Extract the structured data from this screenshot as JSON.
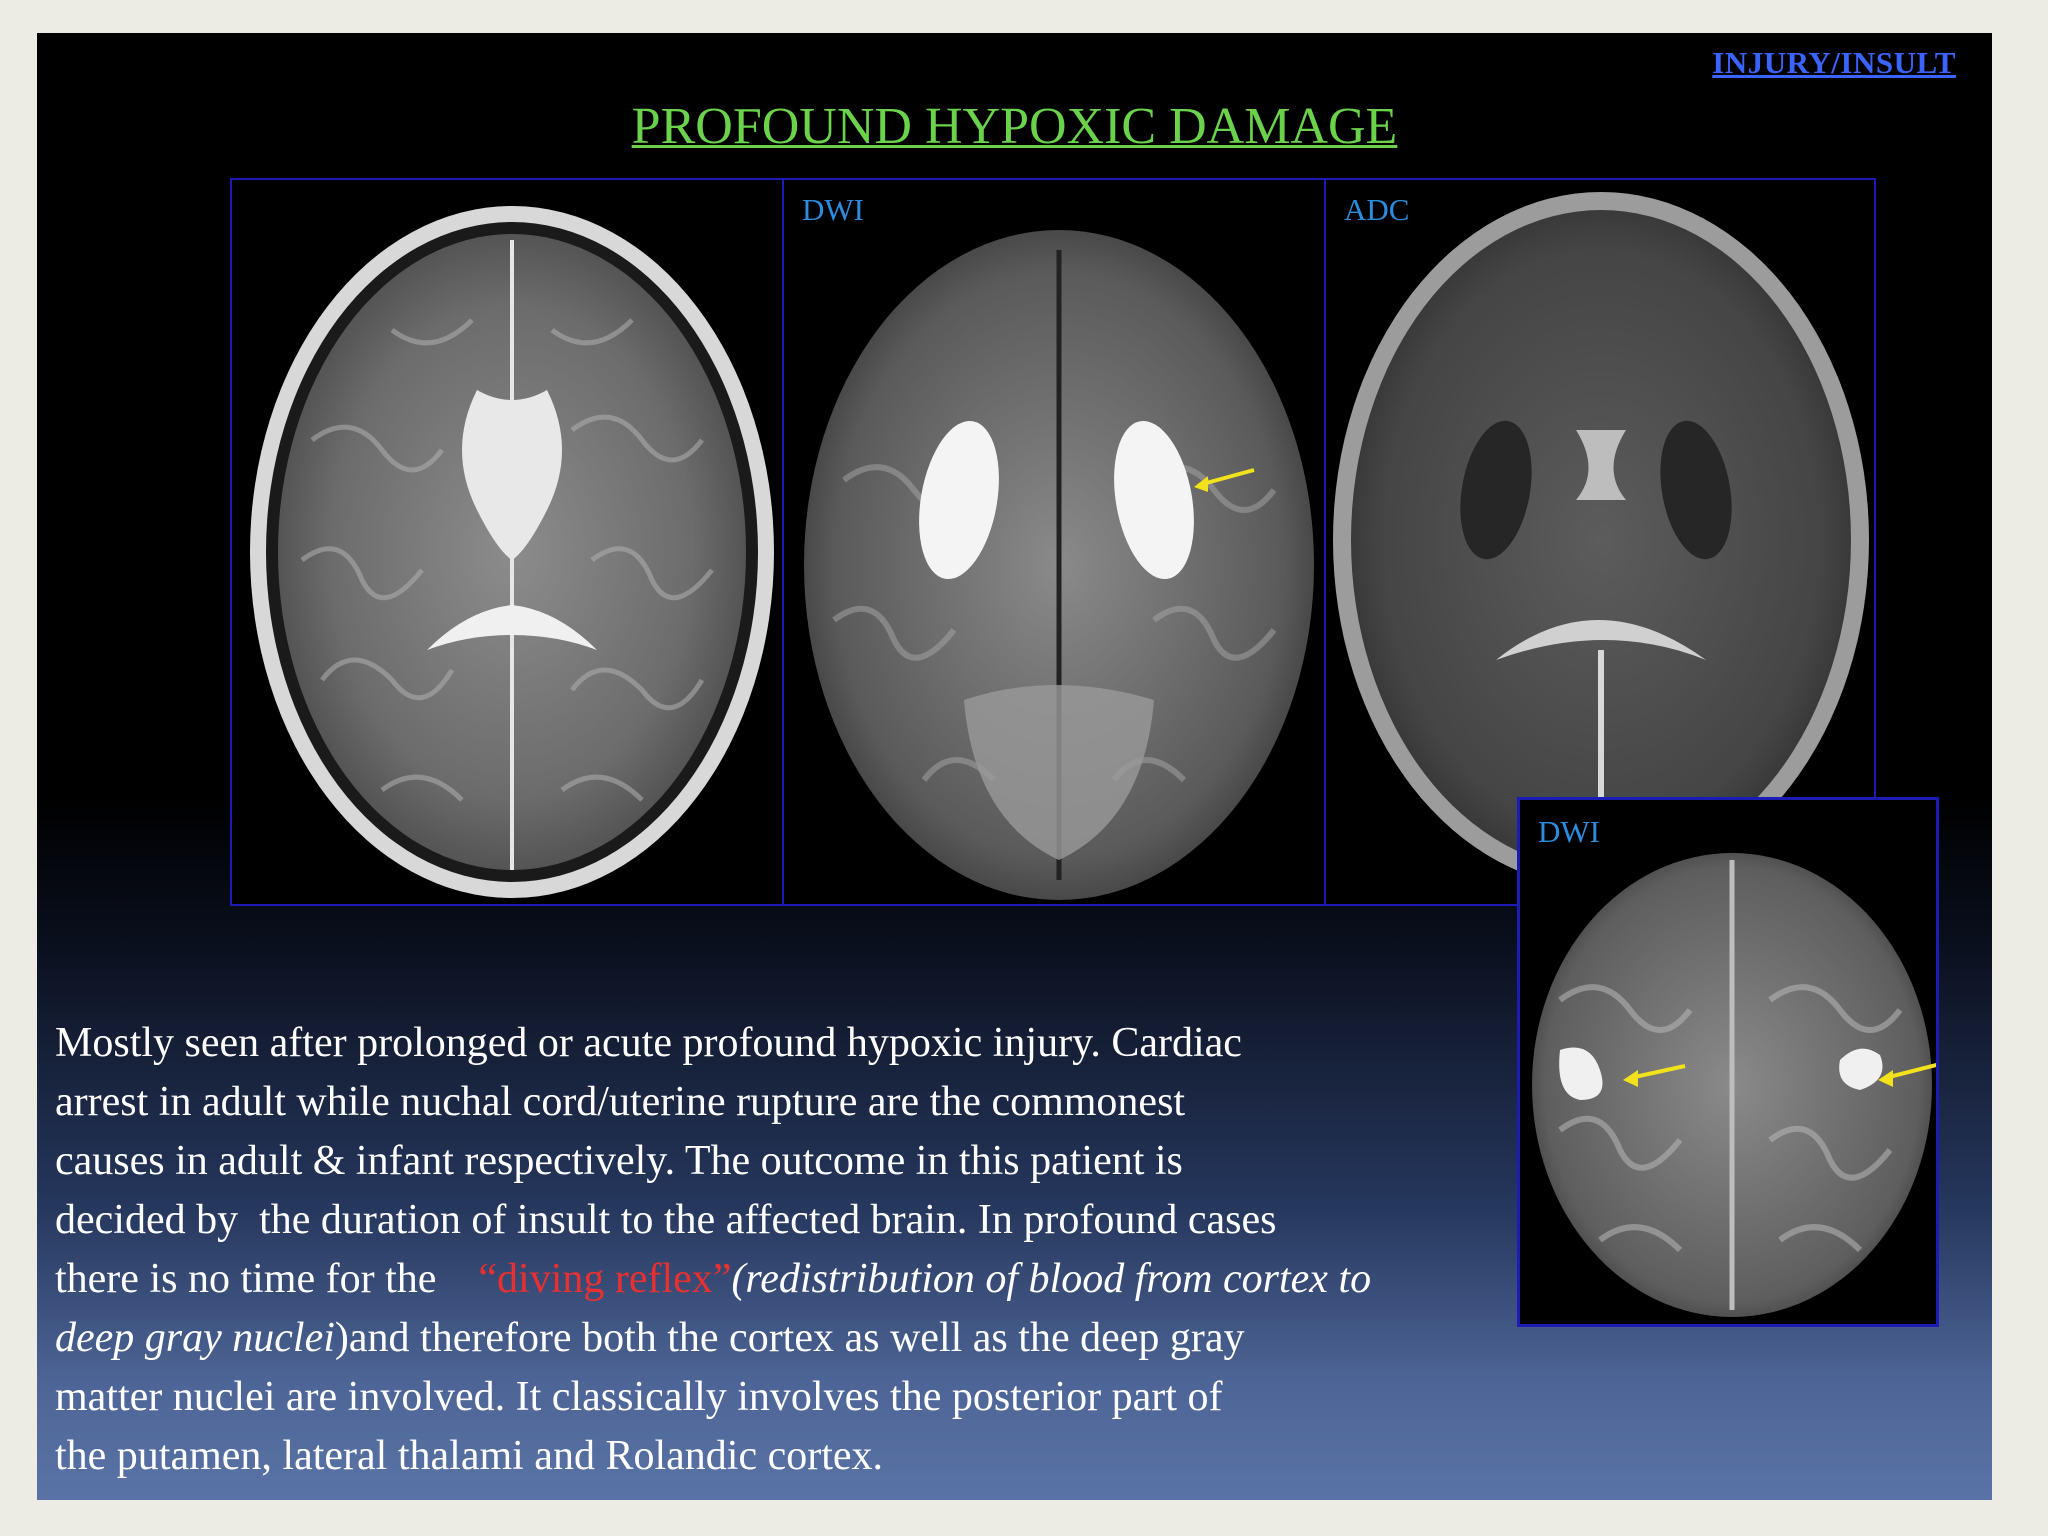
{
  "header": {
    "top_link": "INJURY/INSULT",
    "title": "PROFOUND HYPOXIC DAMAGE"
  },
  "panels": {
    "dwi_label": "DWI",
    "adc_label": "ADC",
    "inset_label": "DWI"
  },
  "body": {
    "line1": "Mostly seen after prolonged or acute profound hypoxic injury. Cardiac",
    "line2": "arrest in adult while nuchal cord/uterine rupture are the commonest",
    "line3": "causes in adult & infant respectively. The outcome in this patient is",
    "line4": "decided by  the duration of insult to the affected brain. In profound cases",
    "line5_a": "there is no time for the ",
    "line5_red": "“diving reflex”",
    "line5_it": "(redistribution of blood from cortex to",
    "line6_it": "deep gray nuclei",
    "line6_b": ")and therefore both the cortex as well as the deep gray",
    "line7": "matter nuclei are involved. It classically involves the posterior part of",
    "line8": "the putamen, lateral thalami and Rolandic cortex."
  },
  "colors": {
    "title": "#6bd24b",
    "link": "#3a63ff",
    "panel_border": "#1c1cb5",
    "label": "#2c8de0",
    "highlight": "#e83030",
    "arrow": "#f2e21c"
  }
}
